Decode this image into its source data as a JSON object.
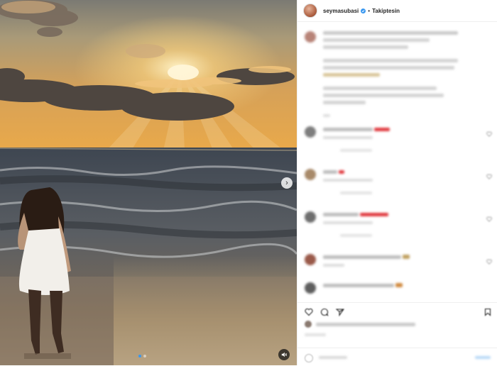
{
  "post": {
    "username": "seymasubasi",
    "separator": "•",
    "follow_label": "Takiptesin"
  },
  "colors": {
    "verified": "#3897f0",
    "link_blue": "#3897f0",
    "text": "#262626",
    "divider": "#efefef",
    "emoji_red": "#e0393e"
  },
  "icons": {
    "verified": "verified-badge-icon",
    "next": "chevron-right-icon",
    "sound": "speaker-icon",
    "like": "heart-icon",
    "comment": "speech-bubble-icon",
    "share": "paper-plane-icon",
    "save": "bookmark-icon",
    "more": "more-options-icon"
  }
}
